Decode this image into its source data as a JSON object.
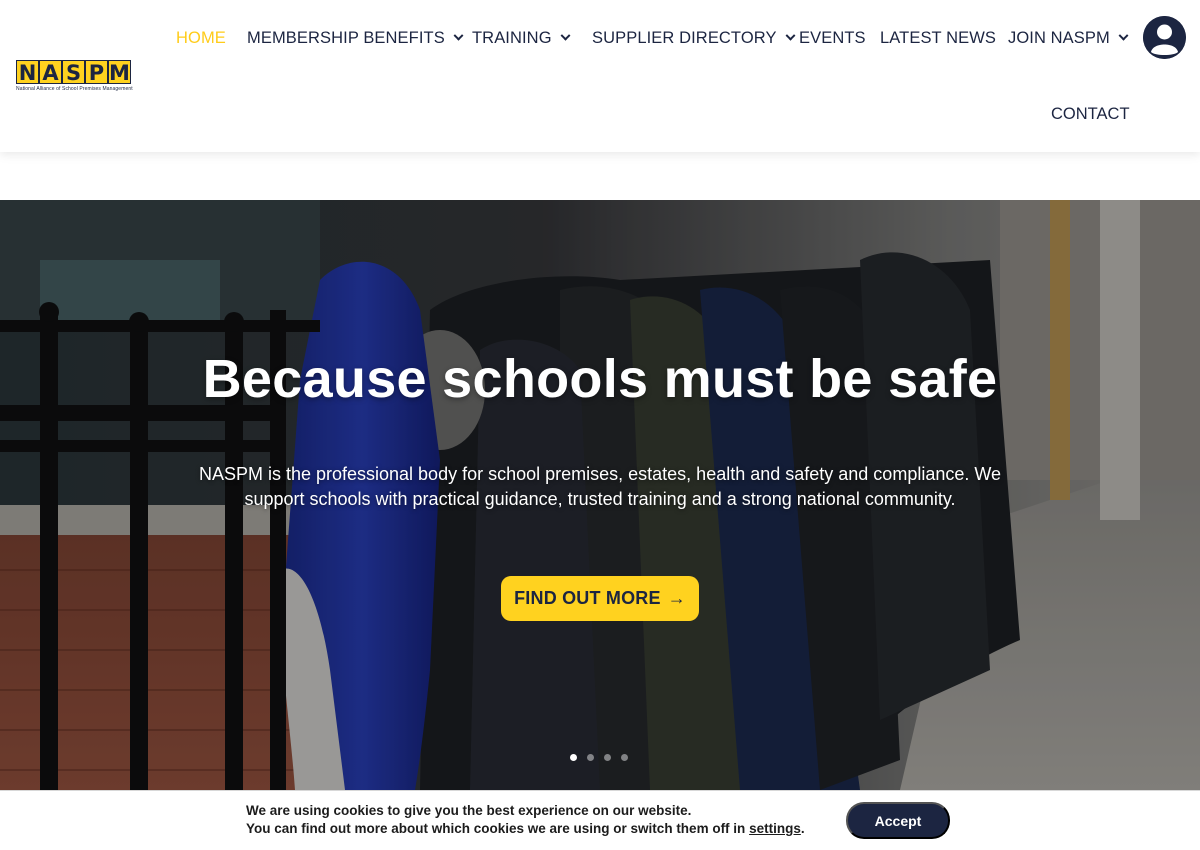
{
  "header": {
    "logo": {
      "letters": [
        "N",
        "A",
        "S",
        "P",
        "M"
      ],
      "tagline": "National Alliance of School Premises Management"
    },
    "nav": [
      {
        "label": "HOME",
        "active": true,
        "dropdown": false
      },
      {
        "label": "MEMBERSHIP BENEFITS",
        "active": false,
        "dropdown": true
      },
      {
        "label": "TRAINING",
        "active": false,
        "dropdown": true
      },
      {
        "label": "SUPPLIER DIRECTORY",
        "active": false,
        "dropdown": true
      },
      {
        "label": "EVENTS",
        "active": false,
        "dropdown": false
      },
      {
        "label": "LATEST NEWS",
        "active": false,
        "dropdown": false
      },
      {
        "label": "JOIN NASPM",
        "active": false,
        "dropdown": true
      },
      {
        "label": "CONTACT",
        "active": false,
        "dropdown": false
      }
    ],
    "account_icon": "user-circle-icon"
  },
  "hero": {
    "title": "Because schools must be safe",
    "text": "NASPM is the professional body for school premises, estates, health and safety and compliance. We support schools with practical guidance, trusted training and a strong national community.",
    "button_label": "FIND OUT MORE",
    "button_icon": "arrow-right-icon",
    "slides_total": 4,
    "slide_active": 1
  },
  "cookie": {
    "line1": "We are using cookies to give you the best experience on our website.",
    "line2_prefix": "You can find out more about which cookies we are using or switch them off in ",
    "settings_link": "settings",
    "line2_suffix": ".",
    "accept_label": "Accept"
  },
  "colors": {
    "brand_navy": "#1c2541",
    "brand_yellow": "#ffd21f",
    "nav_active": "#ffcc1a"
  }
}
